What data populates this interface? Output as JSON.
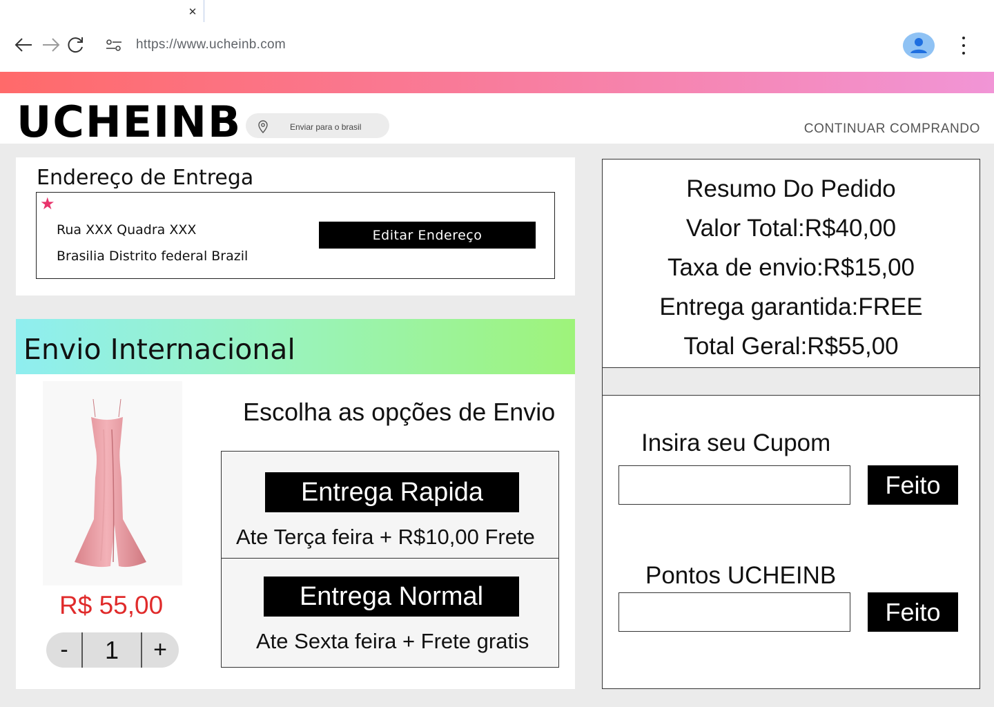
{
  "browser": {
    "tab_close_glyph": "✕",
    "url": "https://www.ucheinb.com"
  },
  "header": {
    "brand": "UCHEINB",
    "ship_to": "Enviar para o brasil",
    "continue_shopping": "CONTINUAR COMPRANDO"
  },
  "address": {
    "title": "Endereço de Entrega",
    "required_mark": "★",
    "line1": "Rua XXX Quadra XXX",
    "line2": "Brasilia Distrito federal Brazil",
    "edit_button": "Editar Endereço"
  },
  "shipping": {
    "title": "Envio Internacional",
    "product": {
      "price": "R$ 55,00",
      "quantity": "1",
      "minus": "-",
      "plus": "+"
    },
    "options_heading": "Escolha as opções de Envio",
    "options": [
      {
        "label": "Entrega Rapida",
        "description": "Ate Terça feira  +  R$10,00 Frete"
      },
      {
        "label": "Entrega Normal",
        "description": "Ate Sexta feira  +  Frete gratis"
      }
    ]
  },
  "summary": {
    "title": "Resumo Do Pedido",
    "total_value": "Valor Total:R$40,00",
    "shipping_fee": "Taxa de envio:R$15,00",
    "guaranteed_delivery": "Entrega garantida:FREE",
    "grand_total": "Total Geral:R$55,00"
  },
  "coupon": {
    "label": "Insira seu Cupom",
    "value": "",
    "button": "Feito"
  },
  "points": {
    "label": "Pontos UCHEINB",
    "value": "",
    "button": "Feito"
  },
  "colors": {
    "accent_red": "#e02b2b",
    "star_pink": "#e8336b",
    "avatar_blue": "#8fc2f4"
  }
}
